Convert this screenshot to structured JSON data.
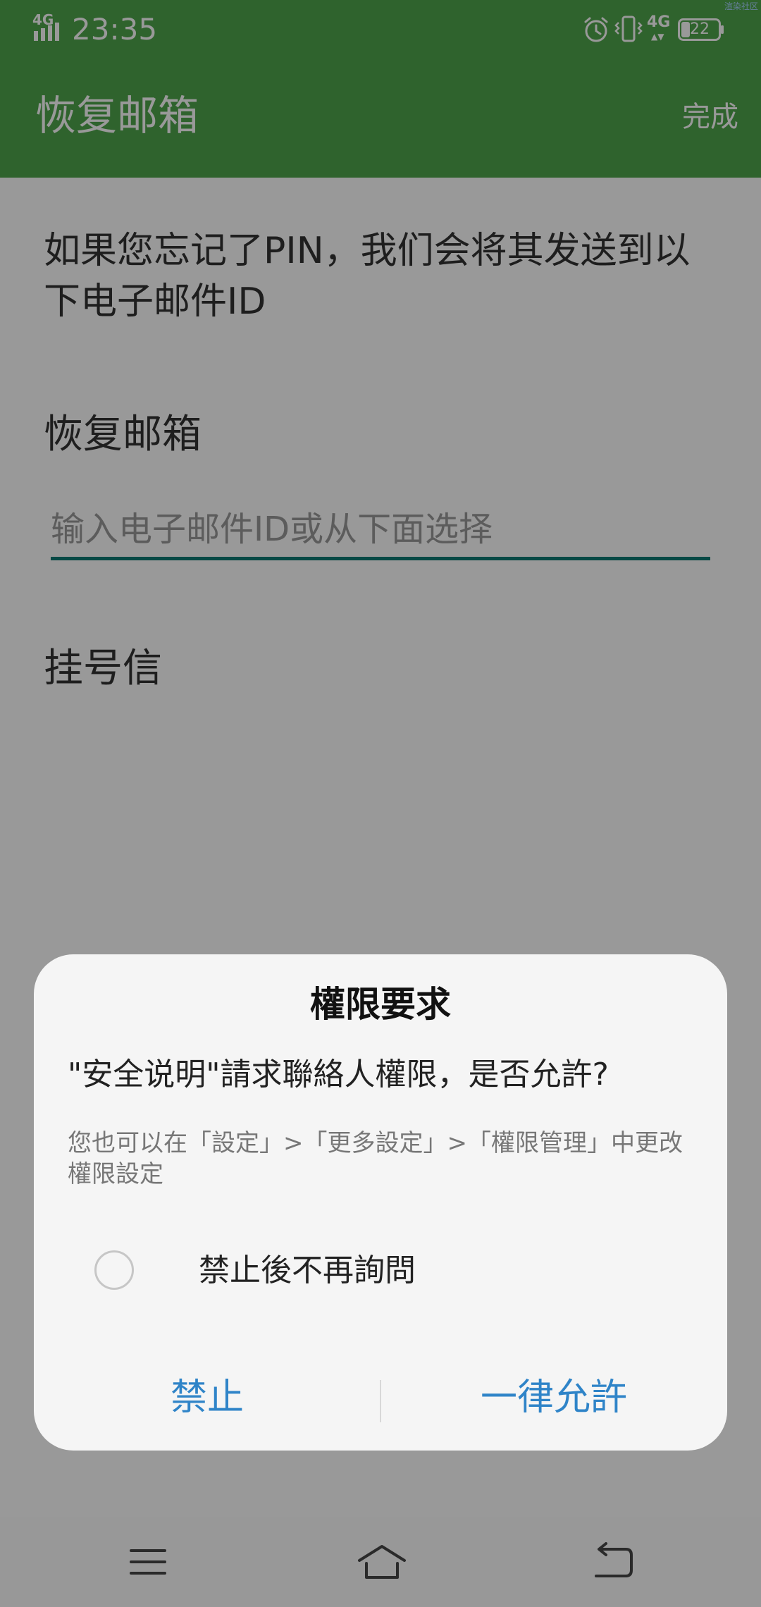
{
  "status_bar": {
    "network_left": "4G",
    "time": "23:35",
    "network_right": "4G",
    "network_arrows": "▲▼",
    "battery": "22",
    "corner_label": "渲染社区",
    "icons": [
      "signal-icon",
      "alarm-icon",
      "vibrate-icon",
      "battery-icon"
    ]
  },
  "app_bar": {
    "title": "恢复邮箱",
    "action": "完成",
    "color": "#4fa64c"
  },
  "content": {
    "intro": "如果您忘记了PIN，我们会将其发送到以下电子邮件ID",
    "email_label": "恢复邮箱",
    "email_placeholder": "输入电子邮件ID或从下面选择",
    "email_value": "",
    "registered_mail_label": "挂号信"
  },
  "dialog": {
    "title": "權限要求",
    "question": "\"安全说明\"請求聯絡人權限，是否允許?",
    "hint": "您也可以在「設定」>「更多設定」>「權限管理」中更改權限設定",
    "checkbox_label": "禁止後不再詢問",
    "checkbox_checked": false,
    "deny_label": "禁止",
    "allow_label": "一律允許",
    "button_color": "#2f84c8"
  },
  "nav_bar": {
    "icons": [
      "menu-icon",
      "home-icon",
      "back-icon"
    ]
  }
}
